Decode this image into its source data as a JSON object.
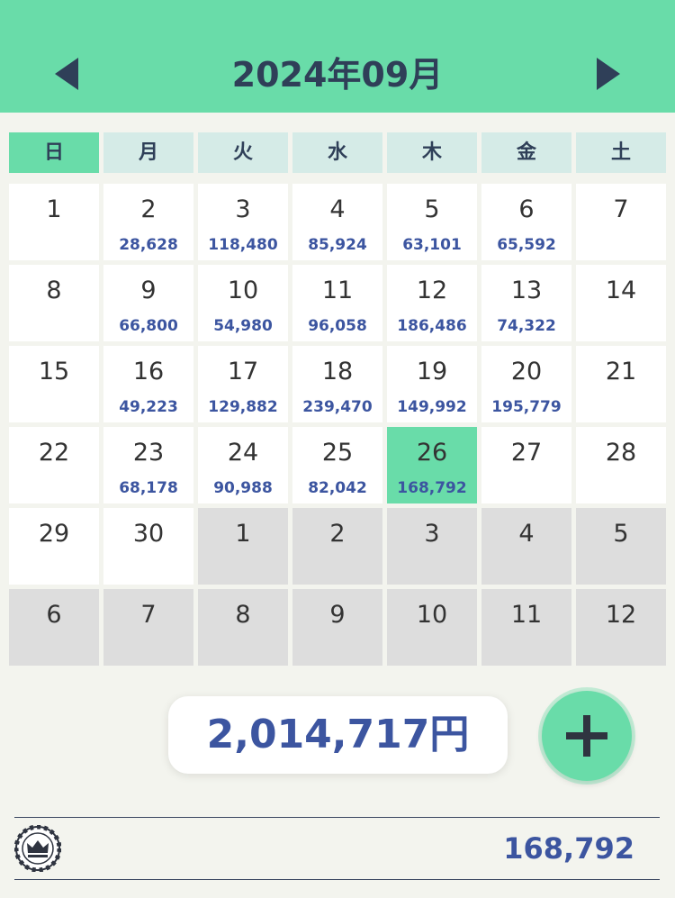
{
  "header": {
    "title": "2024年09月",
    "prev_icon": "triangle-left-icon",
    "next_icon": "triangle-right-icon"
  },
  "weekdays": [
    "日",
    "月",
    "火",
    "水",
    "木",
    "金",
    "土"
  ],
  "calendar": {
    "weeks": [
      [
        {
          "day": "1",
          "amount": "",
          "state": "current"
        },
        {
          "day": "2",
          "amount": "28,628",
          "state": "current"
        },
        {
          "day": "3",
          "amount": "118,480",
          "state": "current"
        },
        {
          "day": "4",
          "amount": "85,924",
          "state": "current"
        },
        {
          "day": "5",
          "amount": "63,101",
          "state": "current"
        },
        {
          "day": "6",
          "amount": "65,592",
          "state": "current"
        },
        {
          "day": "7",
          "amount": "",
          "state": "current"
        }
      ],
      [
        {
          "day": "8",
          "amount": "",
          "state": "current"
        },
        {
          "day": "9",
          "amount": "66,800",
          "state": "current"
        },
        {
          "day": "10",
          "amount": "54,980",
          "state": "current"
        },
        {
          "day": "11",
          "amount": "96,058",
          "state": "current"
        },
        {
          "day": "12",
          "amount": "186,486",
          "state": "current"
        },
        {
          "day": "13",
          "amount": "74,322",
          "state": "current"
        },
        {
          "day": "14",
          "amount": "",
          "state": "current"
        }
      ],
      [
        {
          "day": "15",
          "amount": "",
          "state": "current"
        },
        {
          "day": "16",
          "amount": "49,223",
          "state": "current"
        },
        {
          "day": "17",
          "amount": "129,882",
          "state": "current"
        },
        {
          "day": "18",
          "amount": "239,470",
          "state": "current"
        },
        {
          "day": "19",
          "amount": "149,992",
          "state": "current"
        },
        {
          "day": "20",
          "amount": "195,779",
          "state": "current"
        },
        {
          "day": "21",
          "amount": "",
          "state": "current"
        }
      ],
      [
        {
          "day": "22",
          "amount": "",
          "state": "current"
        },
        {
          "day": "23",
          "amount": "68,178",
          "state": "current"
        },
        {
          "day": "24",
          "amount": "90,988",
          "state": "current"
        },
        {
          "day": "25",
          "amount": "82,042",
          "state": "current"
        },
        {
          "day": "26",
          "amount": "168,792",
          "state": "today"
        },
        {
          "day": "27",
          "amount": "",
          "state": "current"
        },
        {
          "day": "28",
          "amount": "",
          "state": "current"
        }
      ],
      [
        {
          "day": "29",
          "amount": "",
          "state": "current"
        },
        {
          "day": "30",
          "amount": "",
          "state": "current"
        },
        {
          "day": "1",
          "amount": "",
          "state": "other"
        },
        {
          "day": "2",
          "amount": "",
          "state": "other"
        },
        {
          "day": "3",
          "amount": "",
          "state": "other"
        },
        {
          "day": "4",
          "amount": "",
          "state": "other"
        },
        {
          "day": "5",
          "amount": "",
          "state": "other"
        }
      ],
      [
        {
          "day": "6",
          "amount": "",
          "state": "other"
        },
        {
          "day": "7",
          "amount": "",
          "state": "other"
        },
        {
          "day": "8",
          "amount": "",
          "state": "other"
        },
        {
          "day": "9",
          "amount": "",
          "state": "other"
        },
        {
          "day": "10",
          "amount": "",
          "state": "other"
        },
        {
          "day": "11",
          "amount": "",
          "state": "other"
        },
        {
          "day": "12",
          "amount": "",
          "state": "other"
        }
      ]
    ]
  },
  "summary": {
    "total": "2,014,717円",
    "add_icon": "plus-icon"
  },
  "footer": {
    "icon": "crown-badge-icon",
    "value": "168,792"
  },
  "colors": {
    "accent_green": "#69dca9",
    "amount_blue": "#3c55a0",
    "title_navy": "#2f3f58",
    "weekday_bg": "#d5ebe7",
    "other_month_bg": "#dddddd"
  }
}
